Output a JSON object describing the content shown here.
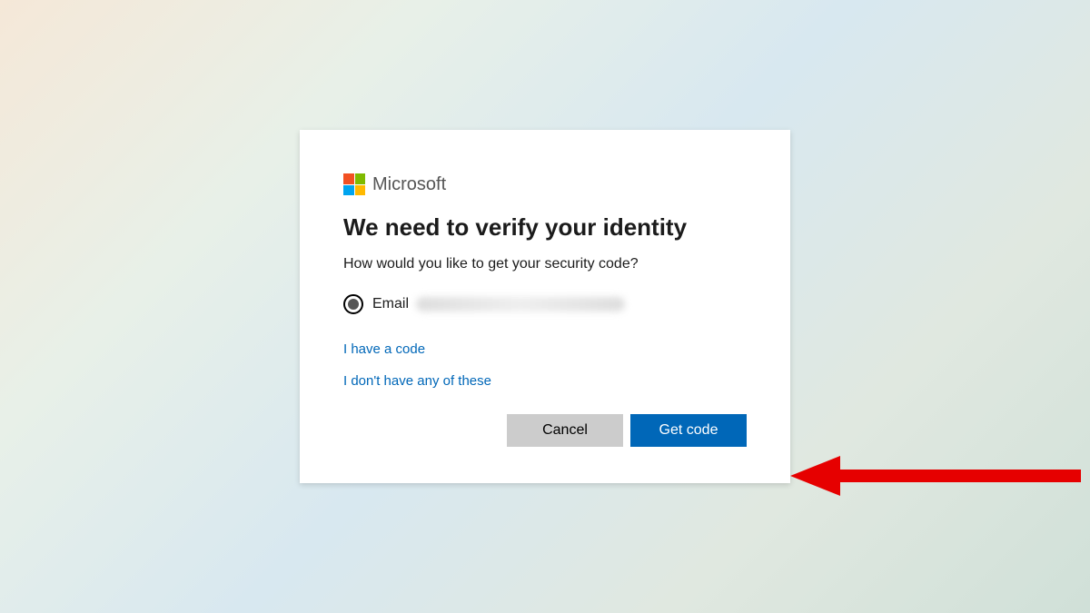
{
  "brand": "Microsoft",
  "heading": "We need to verify your identity",
  "subheading": "How would you like to get your security code?",
  "option": {
    "prefix": "Email"
  },
  "links": {
    "have_code": "I have a code",
    "none_of_these": "I don't have any of these"
  },
  "buttons": {
    "cancel": "Cancel",
    "get_code": "Get code"
  }
}
